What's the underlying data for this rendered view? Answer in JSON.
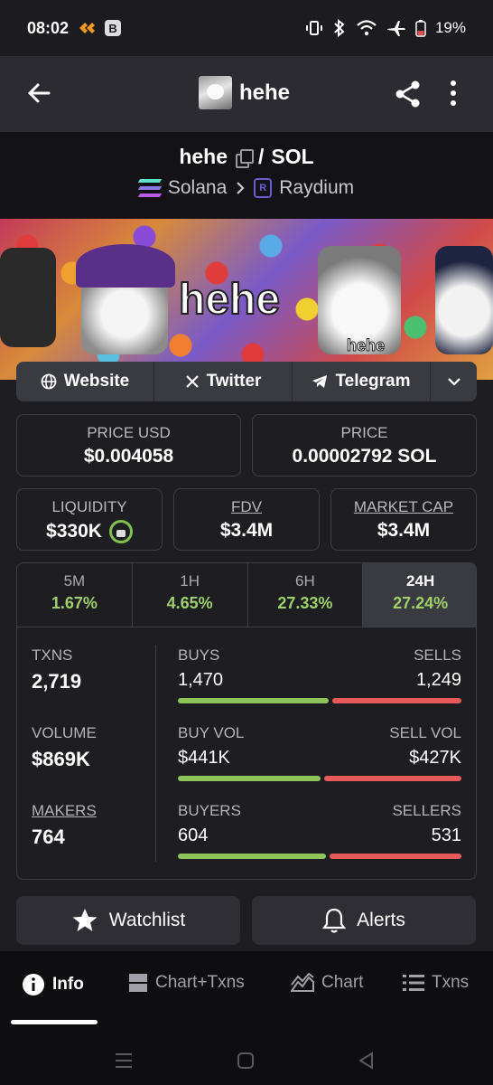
{
  "status_bar": {
    "time": "08:02",
    "battery": "19%",
    "b_badge": "B"
  },
  "app_bar": {
    "title": "hehe"
  },
  "pair": {
    "base": "hehe",
    "separator": "/",
    "quote": "SOL",
    "chain": "Solana",
    "dex": "Raydium"
  },
  "banner": {
    "title": "hehe",
    "tag": "hehe"
  },
  "links": [
    {
      "label": "Website"
    },
    {
      "label": "Twitter"
    },
    {
      "label": "Telegram"
    }
  ],
  "prices": {
    "price_usd_label": "PRICE USD",
    "price_usd": "$0.004058",
    "price_label": "PRICE",
    "price": "0.00002792 SOL"
  },
  "market": {
    "liquidity_label": "LIQUIDITY",
    "liquidity": "$330K",
    "fdv_label": "FDV",
    "fdv": "$3.4M",
    "mcap_label": "MARKET CAP",
    "mcap": "$3.4M"
  },
  "timeframes": [
    {
      "label": "5M",
      "change": "1.67%"
    },
    {
      "label": "1H",
      "change": "4.65%"
    },
    {
      "label": "6H",
      "change": "27.33%"
    },
    {
      "label": "24H",
      "change": "27.24%",
      "active": true
    }
  ],
  "stats": {
    "txns_label": "TXNS",
    "txns": "2,719",
    "volume_label": "VOLUME",
    "volume": "$869K",
    "makers_label": "MAKERS",
    "makers": "764",
    "buys_label": "BUYS",
    "buys": "1,470",
    "sells_label": "SELLS",
    "sells": "1,249",
    "buy_vol_label": "BUY VOL",
    "buy_vol": "$441K",
    "sell_vol_label": "SELL VOL",
    "sell_vol": "$427K",
    "buyers_label": "BUYERS",
    "buyers": "604",
    "sellers_label": "SELLERS",
    "sellers": "531",
    "buys_share": 0.54,
    "buy_vol_share": 0.51,
    "buyers_share": 0.53
  },
  "actions": {
    "watchlist": "Watchlist",
    "alerts": "Alerts"
  },
  "nav": {
    "info": "Info",
    "chart_txns": "Chart+Txns",
    "chart": "Chart",
    "txns": "Txns"
  },
  "colors": {
    "green": "#9fd16a",
    "red": "#e85a5a",
    "bg": "#1d1d22"
  }
}
